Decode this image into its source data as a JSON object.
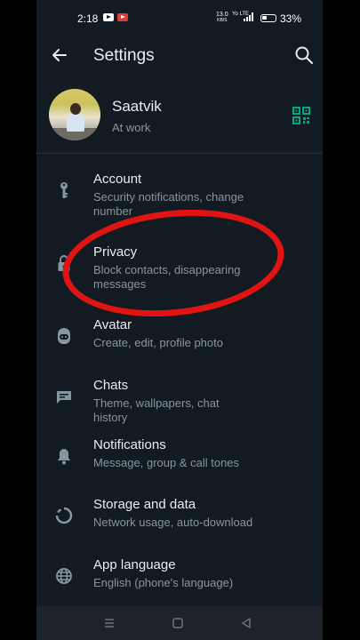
{
  "status_bar": {
    "time": "2:18",
    "net_speed_value": "13.0",
    "net_speed_unit": "KB/S",
    "lte_label": "Yo LTE",
    "battery": "33%"
  },
  "app_bar": {
    "title": "Settings"
  },
  "profile": {
    "name": "Saatvik",
    "status": "At work"
  },
  "settings": [
    {
      "title": "Account",
      "subtitle": "Security notifications, change number",
      "icon": "key-icon"
    },
    {
      "title": "Privacy",
      "subtitle": "Block contacts, disappearing messages",
      "icon": "lock-icon"
    },
    {
      "title": "Avatar",
      "subtitle": "Create, edit, profile photo",
      "icon": "avatar-face-icon"
    },
    {
      "title": "Chats",
      "subtitle": "Theme, wallpapers, chat history",
      "icon": "chat-icon"
    },
    {
      "title": "Notifications",
      "subtitle": "Message, group & call tones",
      "icon": "bell-icon"
    },
    {
      "title": "Storage and data",
      "subtitle": "Network usage, auto-download",
      "icon": "storage-circle-icon"
    },
    {
      "title": "App language",
      "subtitle": "English (phone's language)",
      "icon": "globe-icon"
    }
  ],
  "colors": {
    "background": "#121b22",
    "text_primary": "#e9edef",
    "text_secondary": "#8696a0",
    "accent": "#00a884",
    "highlight_annotation": "#e11414"
  }
}
